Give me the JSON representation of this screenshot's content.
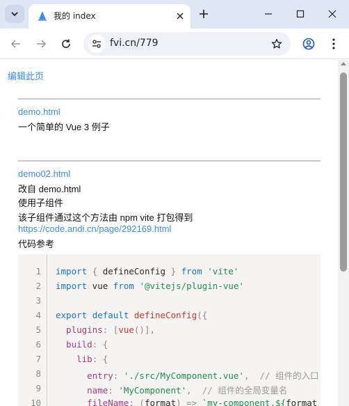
{
  "browser": {
    "tab": {
      "title": "我的 index"
    },
    "url": "fvi.cn/779"
  },
  "page": {
    "edit_link": "编辑此页",
    "section1": {
      "link": "demo.html",
      "desc": "一个简单的 Vue 3 例子"
    },
    "section2": {
      "link": "demo02.html",
      "lines": [
        "改自 demo.html",
        "使用子组件",
        "该子组件通过这个方法由 npm vite 打包得到"
      ],
      "ref_link": "https://code.andi.cn/page/292169.html",
      "ref_label": "代码参考"
    },
    "code": {
      "line_numbers": [
        "1",
        "2",
        "3",
        "4",
        "5",
        "6",
        "7",
        "8",
        "9",
        "10"
      ],
      "l1": {
        "a": "import",
        "b": " { ",
        "c": "defineConfig",
        "d": " } ",
        "e": "from",
        "f": " ",
        "g": "'vite'"
      },
      "l2": {
        "a": "import",
        "b": " vue ",
        "c": "from",
        "d": " ",
        "e": "'@vitejs/plugin-vue'"
      },
      "l4": {
        "a": "export",
        "b": " ",
        "c": "default",
        "d": " ",
        "e": "defineConfig",
        "f": "({"
      },
      "l5": {
        "a": "  plugins",
        "b": ": [",
        "c": "vue",
        "d": "()],",
        "e": ""
      },
      "l6": {
        "a": "  build",
        "b": ": {"
      },
      "l7": {
        "a": "    lib",
        "b": ": {"
      },
      "l8": {
        "a": "      entry",
        "b": ": ",
        "c": "'./src/MyComponent.vue'",
        "d": ",  ",
        "e": "// 组件的入口"
      },
      "l9": {
        "a": "      name",
        "b": ": ",
        "c": "'MyComponent'",
        "d": ",  ",
        "e": "// 组件的全局变量名"
      },
      "l10": {
        "a": "      fileName",
        "b": ": (",
        "c": "format",
        "d": ") => ",
        "e": "`my-component.${",
        "f": "format"
      }
    }
  },
  "colors": {
    "link": "#3a8ee6",
    "tabstrip_bg": "#dfe7f5",
    "code_bg": "#f5f4f2"
  }
}
